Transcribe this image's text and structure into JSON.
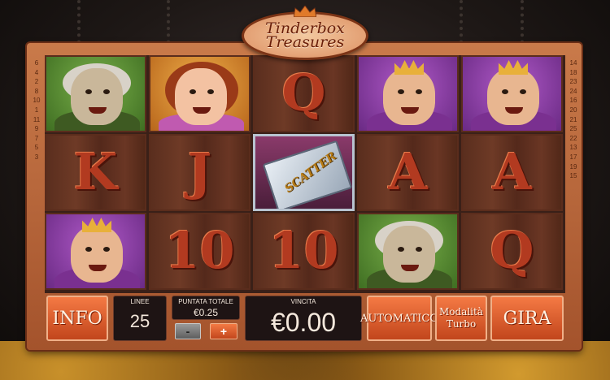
{
  "game": {
    "logo_line1": "Tinderbox",
    "logo_line2": "Treasures"
  },
  "reels": [
    [
      {
        "type": "character",
        "name": "witch",
        "bg": "green"
      },
      {
        "type": "card",
        "label": "K"
      },
      {
        "type": "character",
        "name": "king",
        "bg": "purple"
      }
    ],
    [
      {
        "type": "character",
        "name": "princess",
        "bg": "orange"
      },
      {
        "type": "card",
        "label": "J"
      },
      {
        "type": "card",
        "label": "10"
      }
    ],
    [
      {
        "type": "card",
        "label": "Q"
      },
      {
        "type": "scatter",
        "label": "SCATTER"
      },
      {
        "type": "card",
        "label": "10"
      }
    ],
    [
      {
        "type": "character",
        "name": "king",
        "bg": "purple"
      },
      {
        "type": "card",
        "label": "A"
      },
      {
        "type": "character",
        "name": "witch",
        "bg": "green"
      }
    ],
    [
      {
        "type": "character",
        "name": "king",
        "bg": "purple"
      },
      {
        "type": "card",
        "label": "A"
      },
      {
        "type": "card",
        "label": "Q"
      }
    ]
  ],
  "paylines_left": [
    "6",
    "4",
    "2",
    "8",
    "10",
    "1",
    "11",
    "9",
    "7",
    "5",
    "3"
  ],
  "paylines_right": [
    "14",
    "18",
    "23",
    "24",
    "16",
    "20",
    "21",
    "25",
    "22",
    "13",
    "17",
    "19",
    "15"
  ],
  "controls": {
    "info_label": "INFO",
    "lines_label": "LINEE",
    "lines_value": "25",
    "bet_label": "PUNTATA TOTALE",
    "bet_value": "€0.25",
    "bet_decrease": "-",
    "bet_increase": "+",
    "win_label": "VINCITA",
    "win_value": "€0.00",
    "auto_label": "AUTOMATICO",
    "turbo_label_1": "Modalità",
    "turbo_label_2": "Turbo",
    "spin_label": "GIRA"
  },
  "colors": {
    "accent": "#e0622c",
    "frame": "#b8653a",
    "panel_dark": "#1e1414"
  }
}
